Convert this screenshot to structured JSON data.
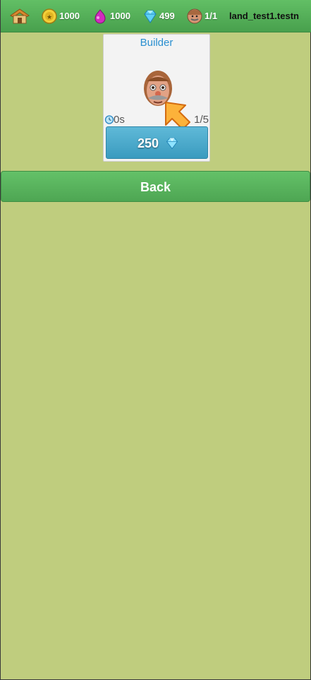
{
  "topbar": {
    "gold": "1000",
    "elixir": "1000",
    "gems": "499",
    "builders": "1/1",
    "land_name": "land_test1.testn"
  },
  "shop_card": {
    "title": "Builder",
    "time": "0s",
    "count": "1/5",
    "price": "250"
  },
  "back_label": "Back",
  "colors": {
    "background": "#bfcd7e",
    "topbar_green": "#4fa854",
    "title_blue": "#2a8fd0",
    "buy_button": "#4aa9cc",
    "back_button": "#58b25d"
  }
}
